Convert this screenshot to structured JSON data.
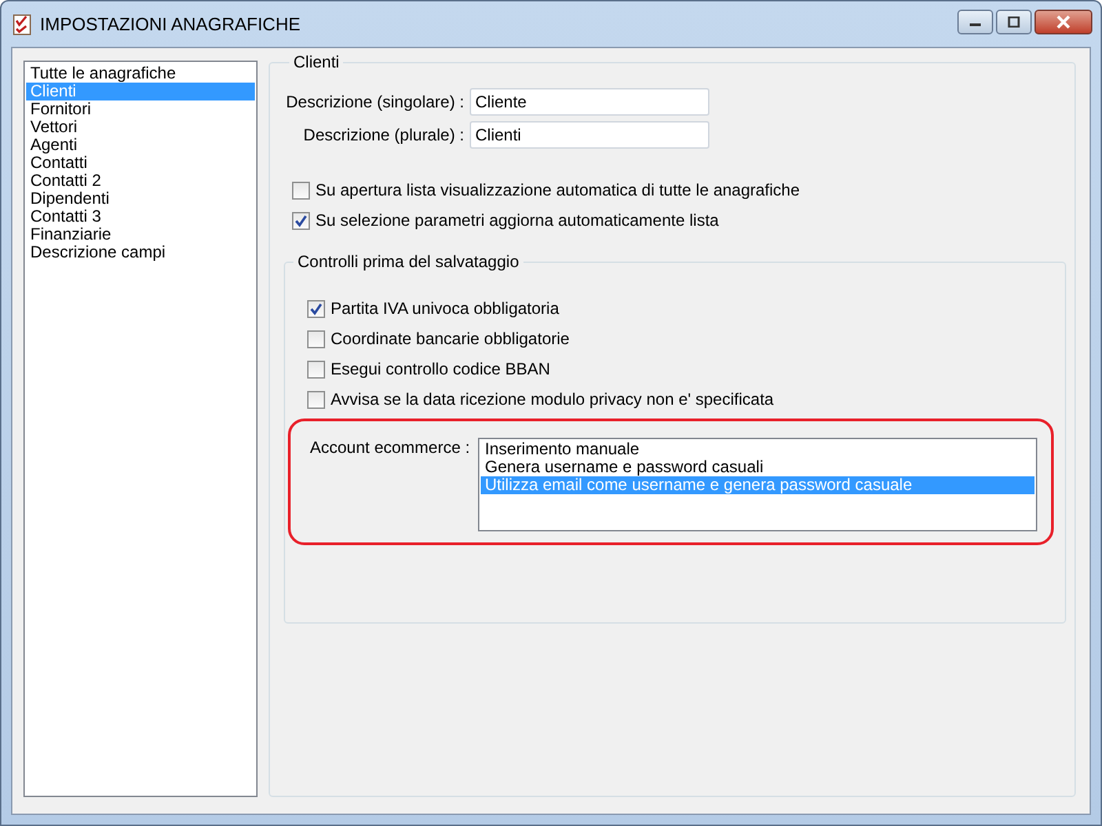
{
  "window": {
    "title": "IMPOSTAZIONI ANAGRAFICHE"
  },
  "sidebar": {
    "items": [
      {
        "label": "Tutte le anagrafiche",
        "selected": false
      },
      {
        "label": "Clienti",
        "selected": true
      },
      {
        "label": "Fornitori",
        "selected": false
      },
      {
        "label": "Vettori",
        "selected": false
      },
      {
        "label": "Agenti",
        "selected": false
      },
      {
        "label": "Contatti",
        "selected": false
      },
      {
        "label": "Contatti 2",
        "selected": false
      },
      {
        "label": "Dipendenti",
        "selected": false
      },
      {
        "label": "Contatti 3",
        "selected": false
      },
      {
        "label": "Finanziarie",
        "selected": false
      },
      {
        "label": "Descrizione campi",
        "selected": false
      }
    ]
  },
  "panel": {
    "title": "Clienti",
    "fields": [
      {
        "label": "Descrizione (singolare) :",
        "value": "Cliente"
      },
      {
        "label": "Descrizione (plurale) :",
        "value": "Clienti"
      }
    ],
    "options": [
      {
        "label": "Su apertura lista visualizzazione automatica di tutte le anagrafiche",
        "checked": false
      },
      {
        "label": "Su selezione parametri aggiorna automaticamente lista",
        "checked": true
      }
    ],
    "checks_group": {
      "title": "Controlli prima del salvataggio",
      "options": [
        {
          "label": "Partita IVA univoca obbligatoria",
          "checked": true
        },
        {
          "label": "Coordinate bancarie obbligatorie",
          "checked": false
        },
        {
          "label": "Esegui controllo codice BBAN",
          "checked": false
        },
        {
          "label": "Avvisa se la data ricezione modulo privacy non e' specificata",
          "checked": false
        }
      ]
    },
    "account": {
      "label": "Account ecommerce :",
      "highlighted": true,
      "items": [
        {
          "label": "Inserimento manuale",
          "selected": false
        },
        {
          "label": "Genera username e password casuali",
          "selected": false
        },
        {
          "label": "Utilizza email come username e genera password casuale",
          "selected": true
        }
      ]
    }
  }
}
